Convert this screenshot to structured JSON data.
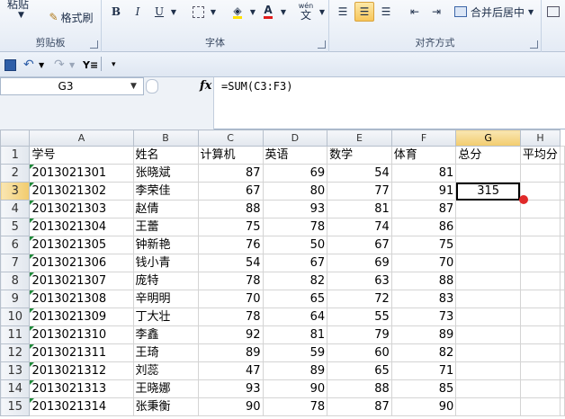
{
  "ribbon": {
    "paste": "粘贴",
    "format_painter": "格式刷",
    "clipboard": "剪贴板",
    "bold": "B",
    "italic": "I",
    "underline": "U",
    "font_group": "字体",
    "align_group": "对齐方式",
    "merge_center": "合并后居中",
    "wen_label": "wén",
    "wen_char": "文",
    "font_color_letter": "A"
  },
  "formula_bar": {
    "name_box": "G3",
    "fx": "fx",
    "formula": "=SUM(C3:F3)"
  },
  "grid": {
    "columns": [
      "A",
      "B",
      "C",
      "D",
      "E",
      "F",
      "G",
      "H"
    ],
    "rows": [
      [
        "学号",
        "姓名",
        "计算机",
        "英语",
        "数学",
        "体育",
        "总分",
        "平均分"
      ],
      [
        "2013021301",
        "张晓斌",
        "87",
        "69",
        "54",
        "81",
        "",
        ""
      ],
      [
        "2013021302",
        "李荣佳",
        "67",
        "80",
        "77",
        "91",
        "315",
        ""
      ],
      [
        "2013021303",
        "赵倩",
        "88",
        "93",
        "81",
        "87",
        "",
        ""
      ],
      [
        "2013021304",
        "王蕾",
        "75",
        "78",
        "74",
        "86",
        "",
        ""
      ],
      [
        "2013021305",
        "钟新艳",
        "76",
        "50",
        "67",
        "75",
        "",
        ""
      ],
      [
        "2013021306",
        "钱小青",
        "54",
        "67",
        "69",
        "70",
        "",
        ""
      ],
      [
        "2013021307",
        "庞特",
        "78",
        "82",
        "63",
        "88",
        "",
        ""
      ],
      [
        "2013021308",
        "辛明明",
        "70",
        "65",
        "72",
        "83",
        "",
        ""
      ],
      [
        "2013021309",
        "丁大壮",
        "78",
        "64",
        "55",
        "73",
        "",
        ""
      ],
      [
        "2013021310",
        "李鑫",
        "92",
        "81",
        "79",
        "89",
        "",
        ""
      ],
      [
        "2013021311",
        "王琦",
        "89",
        "59",
        "60",
        "82",
        "",
        ""
      ],
      [
        "2013021312",
        "刘蕊",
        "47",
        "89",
        "65",
        "71",
        "",
        ""
      ],
      [
        "2013021313",
        "王晓娜",
        "93",
        "90",
        "88",
        "85",
        "",
        ""
      ],
      [
        "2013021314",
        "张秉衡",
        "90",
        "78",
        "87",
        "90",
        "",
        ""
      ]
    ]
  },
  "colors": {
    "accent": "#f7c65a",
    "selection_border": "#000000",
    "fill_handle": "#e02a2a"
  }
}
